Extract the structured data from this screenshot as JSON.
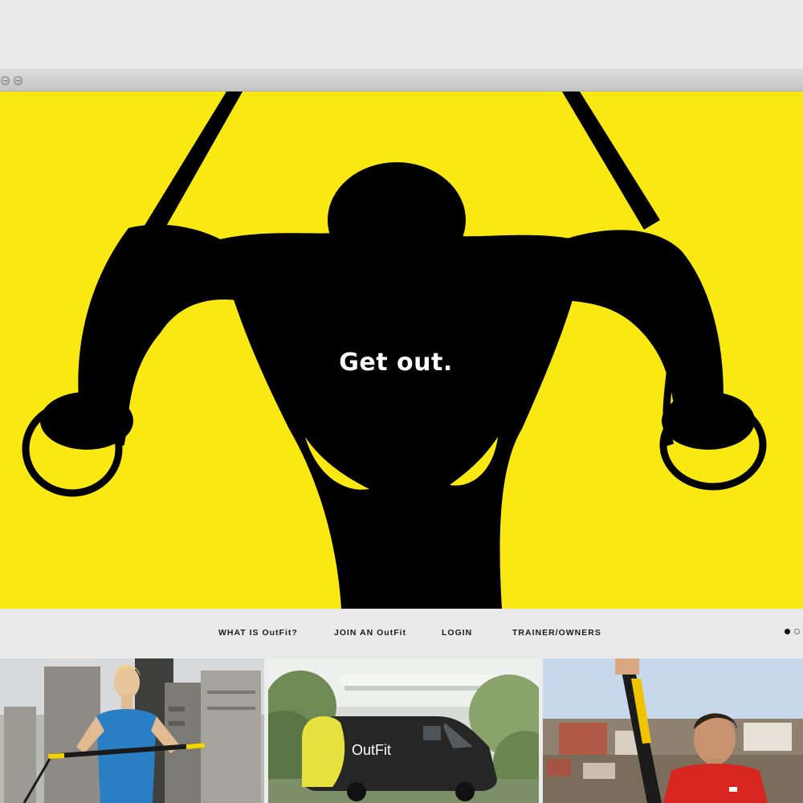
{
  "hero": {
    "headline": "Get out.",
    "background_color": "#f9e812"
  },
  "nav": {
    "items": [
      {
        "label": "WHAT IS OutFit?"
      },
      {
        "label": "JOIN AN OutFit"
      },
      {
        "label": "LOGIN"
      },
      {
        "label": "TRAINER/OWNERS"
      }
    ]
  },
  "carousel": {
    "slide_count": 2,
    "active_slide": 1
  },
  "tiles": [
    {
      "subject": "woman-training-with-bar-photo"
    },
    {
      "subject": "outfit-van-photo",
      "van_logo": "OutFit"
    },
    {
      "subject": "man-training-with-straps-photo"
    }
  ]
}
